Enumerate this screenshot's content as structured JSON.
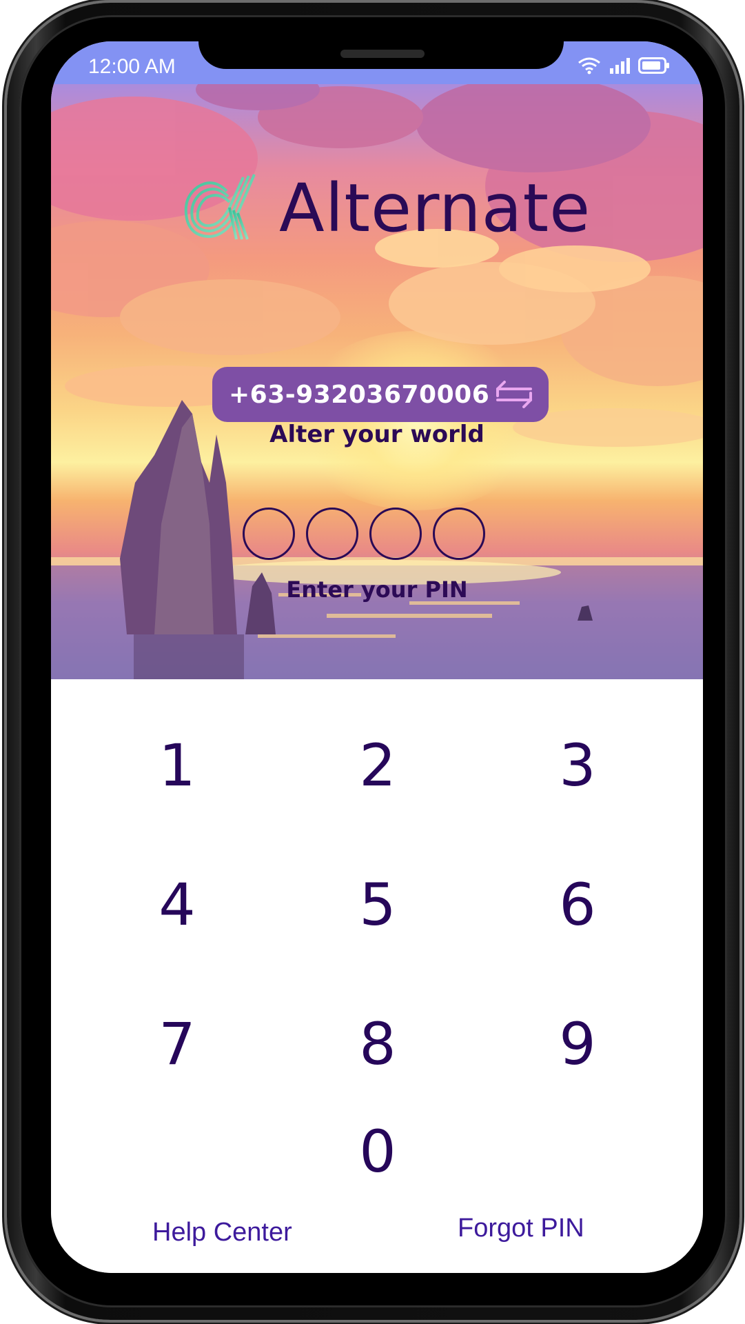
{
  "status_bar": {
    "time": "12:00 AM"
  },
  "brand": {
    "name": "Alternate",
    "logo_icon": "alpha-logo-icon",
    "colors": {
      "logo_gradient_start": "#2fb78f",
      "logo_gradient_end": "#8fe0c0",
      "text": "#2a0a56"
    }
  },
  "account": {
    "phone_number": "+63-93203670006",
    "switch_icon": "swap-arrows-icon"
  },
  "tagline": "Alter your world",
  "pin": {
    "label": "Enter your PIN",
    "length": 4,
    "entered": 0
  },
  "keypad": {
    "keys": [
      "1",
      "2",
      "3",
      "4",
      "5",
      "6",
      "7",
      "8",
      "9",
      "0"
    ]
  },
  "footer": {
    "help_center": "Help Center",
    "forgot_pin": "Forgot PIN"
  },
  "colors": {
    "accent_pill": "#7e4fa5",
    "keypad_text": "#26075a",
    "link": "#3d1a9c",
    "status_bar": "#8392f3"
  }
}
